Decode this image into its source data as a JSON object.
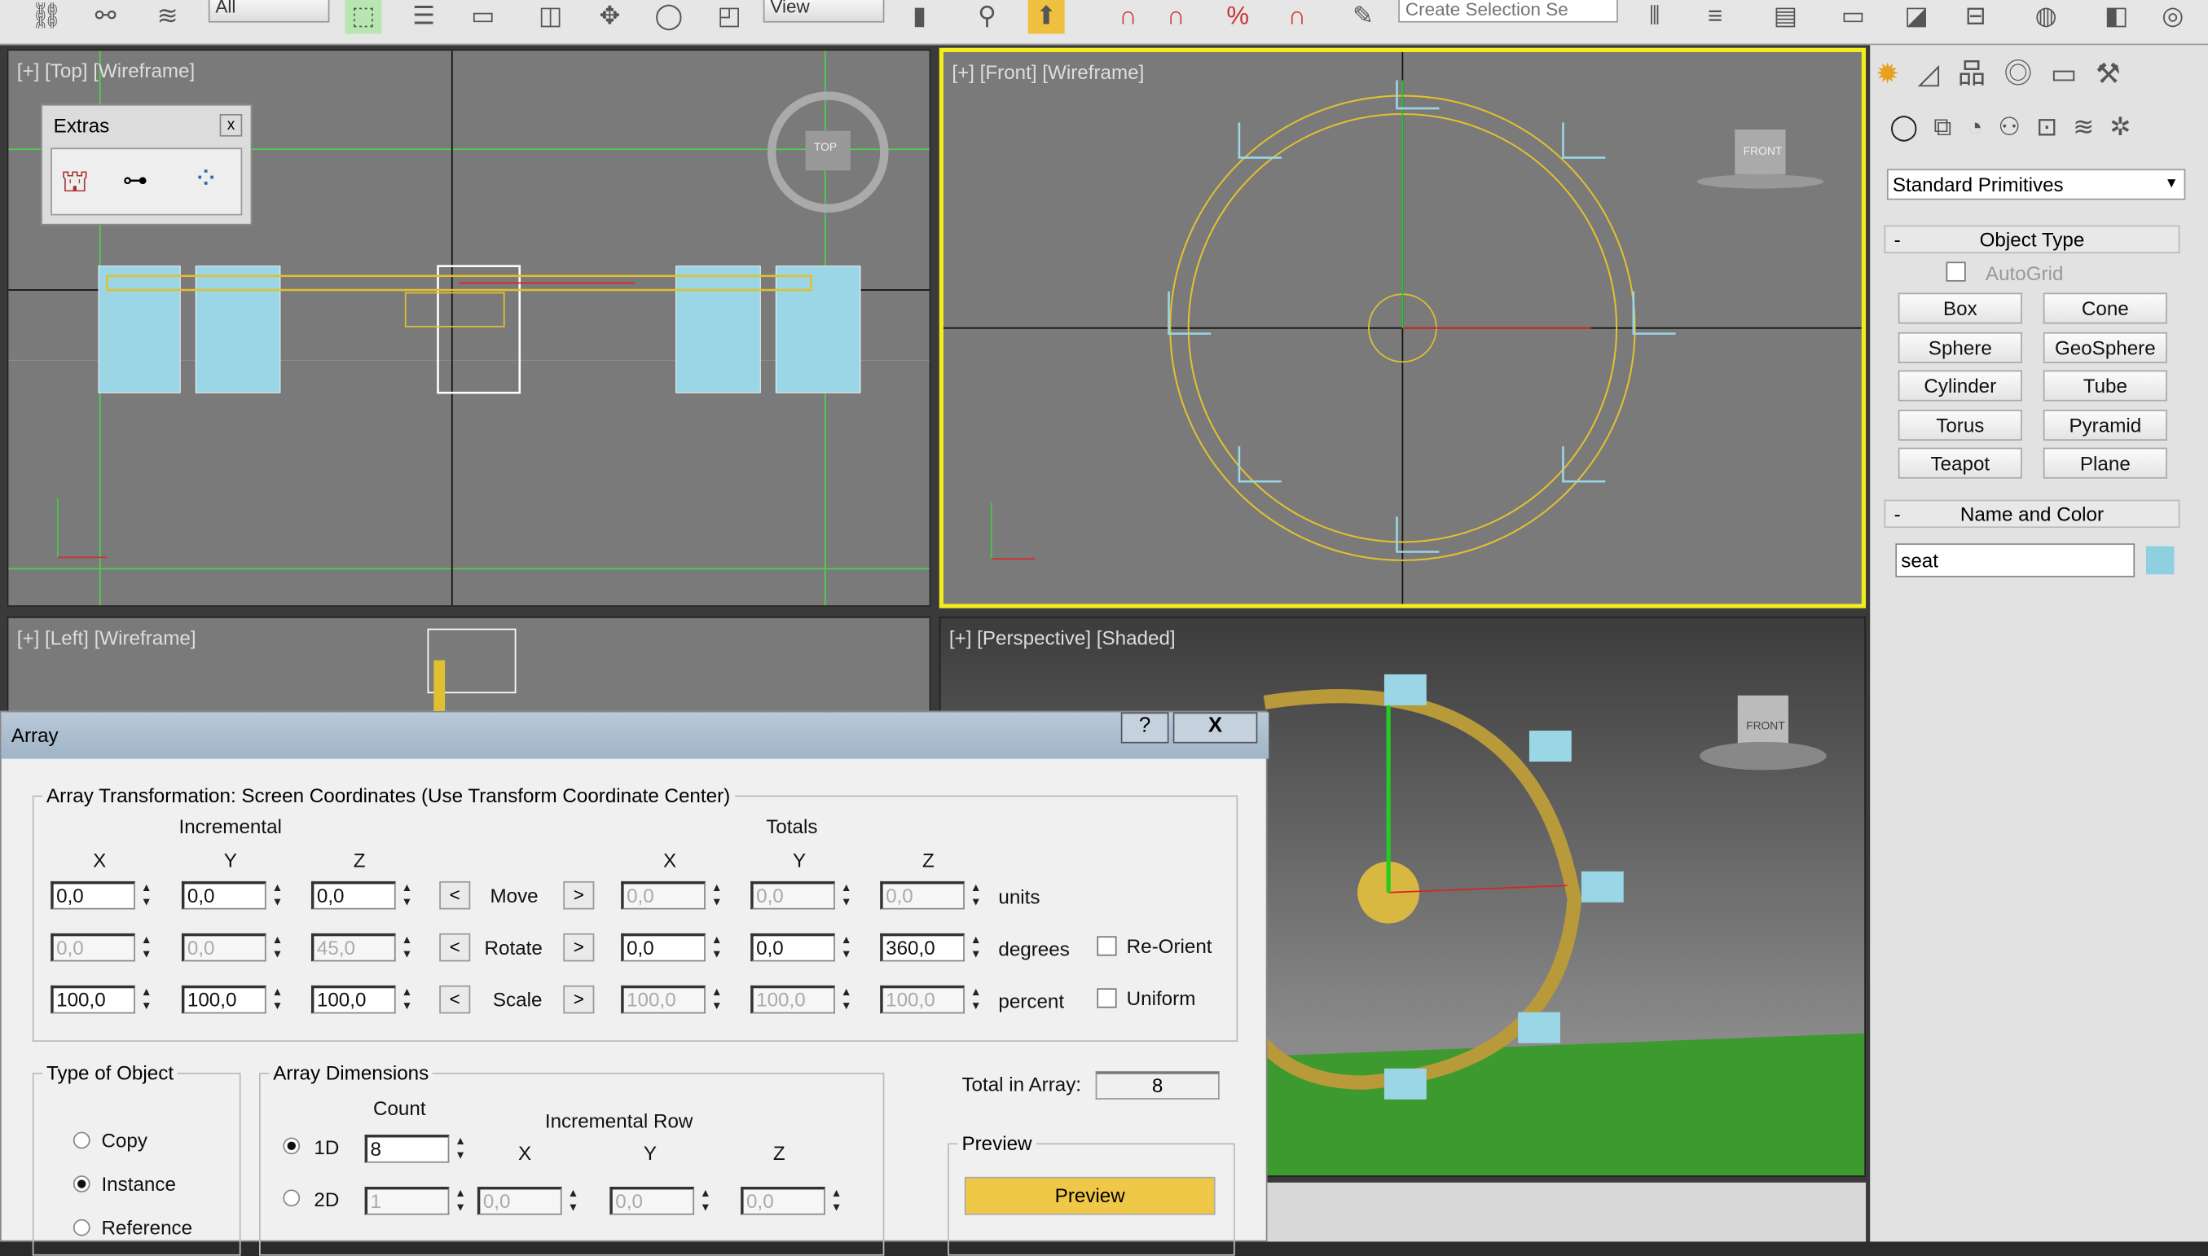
{
  "toolbar": {
    "selection_filter": "All",
    "ref_coord": "View",
    "named_selection_placeholder": "Create Selection Se"
  },
  "viewports": {
    "top": {
      "label": "[+] [Top] [Wireframe]"
    },
    "front": {
      "label": "[+] [Front] [Wireframe]",
      "cube": "FRONT"
    },
    "left": {
      "label": "[+] [Left] [Wireframe]"
    },
    "perspective": {
      "label": "[+] [Perspective] [Shaded]",
      "cube": "FRONT"
    },
    "top_cube": "TOP"
  },
  "extras": {
    "title": "Extras",
    "close": "x"
  },
  "command_panel": {
    "dropdown": "Standard Primitives",
    "object_type": {
      "title": "Object Type",
      "collapse": "-",
      "autogrid": "AutoGrid",
      "buttons": [
        "Box",
        "Cone",
        "Sphere",
        "GeoSphere",
        "Cylinder",
        "Tube",
        "Torus",
        "Pyramid",
        "Teapot",
        "Plane"
      ]
    },
    "name_color": {
      "title": "Name and Color",
      "collapse": "-",
      "name": "seat",
      "color": "#8fd0e0"
    }
  },
  "array": {
    "title": "Array",
    "help": "?",
    "close": "X",
    "transform_title": "Array Transformation: Screen Coordinates (Use Transform Coordinate Center)",
    "incremental": "Incremental",
    "totals": "Totals",
    "axes": [
      "X",
      "Y",
      "Z"
    ],
    "rows": [
      {
        "label": "Move",
        "inc": [
          "0,0",
          "0,0",
          "0,0"
        ],
        "inc_enabled": true,
        "tot": [
          "0,0",
          "0,0",
          "0,0"
        ],
        "tot_enabled": false,
        "unit": "units"
      },
      {
        "label": "Rotate",
        "inc": [
          "0,0",
          "0,0",
          "45,0"
        ],
        "inc_enabled": false,
        "tot": [
          "0,0",
          "0,0",
          "360,0"
        ],
        "tot_enabled": true,
        "unit": "degrees",
        "check": "Re-Orient"
      },
      {
        "label": "Scale",
        "inc": [
          "100,0",
          "100,0",
          "100,0"
        ],
        "inc_enabled": true,
        "tot": [
          "100,0",
          "100,0",
          "100,0"
        ],
        "tot_enabled": false,
        "unit": "percent",
        "check": "Uniform"
      }
    ],
    "left_arrow": "<",
    "right_arrow": ">",
    "type_of_object": {
      "title": "Type of Object",
      "options": [
        "Copy",
        "Instance",
        "Reference"
      ],
      "selected": "Instance"
    },
    "dimensions": {
      "title": "Array Dimensions",
      "count": "Count",
      "incremental_row": "Incremental Row",
      "dims": [
        {
          "label": "1D",
          "count": "8"
        },
        {
          "label": "2D",
          "count": "1",
          "x": "0,0",
          "y": "0,0",
          "z": "0,0"
        }
      ],
      "selected": "1D"
    },
    "total_label": "Total in Array:",
    "total": "8",
    "preview": {
      "title": "Preview",
      "button": "Preview"
    }
  }
}
